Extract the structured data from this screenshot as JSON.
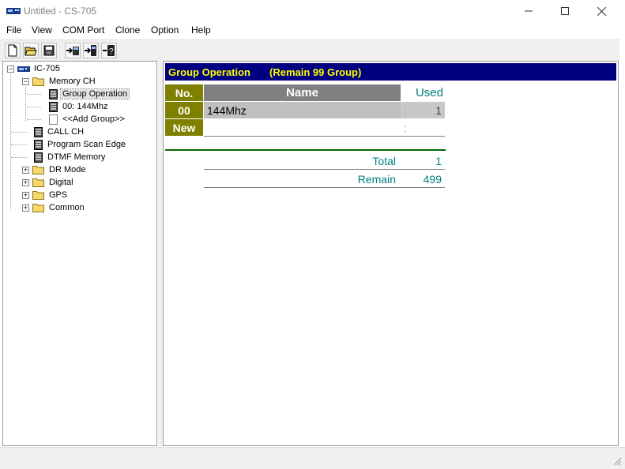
{
  "window": {
    "title": "Untitled - CS-705",
    "icon": "radio-app-icon",
    "controls": [
      "minimize-icon",
      "maximize-icon",
      "close-icon"
    ]
  },
  "menu": [
    "File",
    "View",
    "COM Port",
    "Clone",
    "Option",
    "Help"
  ],
  "toolbar": {
    "buttons": [
      "new-file-icon",
      "open-folder-icon",
      "save-disk-icon",
      "read-from-radio-icon",
      "write-to-radio-icon",
      "radio-info-icon"
    ]
  },
  "tree": {
    "root": "IC-705",
    "memory_ch": "Memory CH",
    "group_operation": "Group Operation",
    "group_00": "00: 144Mhz",
    "add_group": "<<Add Group>>",
    "call_ch": "CALL CH",
    "program_scan_edge": "Program Scan Edge",
    "dtmf_memory": "DTMF Memory",
    "dr_mode": "DR Mode",
    "digital": "Digital",
    "gps": "GPS",
    "common": "Common",
    "expand_minus": "−",
    "expand_plus": "+"
  },
  "panel": {
    "title": "Group Operation",
    "remain_label": "(Remain  99 Group)",
    "columns": {
      "no": "No.",
      "name": "Name",
      "used": "Used"
    },
    "rows": [
      {
        "no": "00",
        "name": "144Mhz",
        "sep": ":",
        "used": "1"
      },
      {
        "no": "New",
        "name": "",
        "sep": ":",
        "used": ""
      }
    ],
    "total_label": "Total",
    "total_value": "1",
    "remain_label2": "Remain",
    "remain_value": "499"
  },
  "colors": {
    "header_bg": "#000080",
    "header_text": "#ffff00",
    "olive": "#808000",
    "gray_header": "#808080",
    "teal_text": "#008080",
    "divider_green": "#006400"
  }
}
